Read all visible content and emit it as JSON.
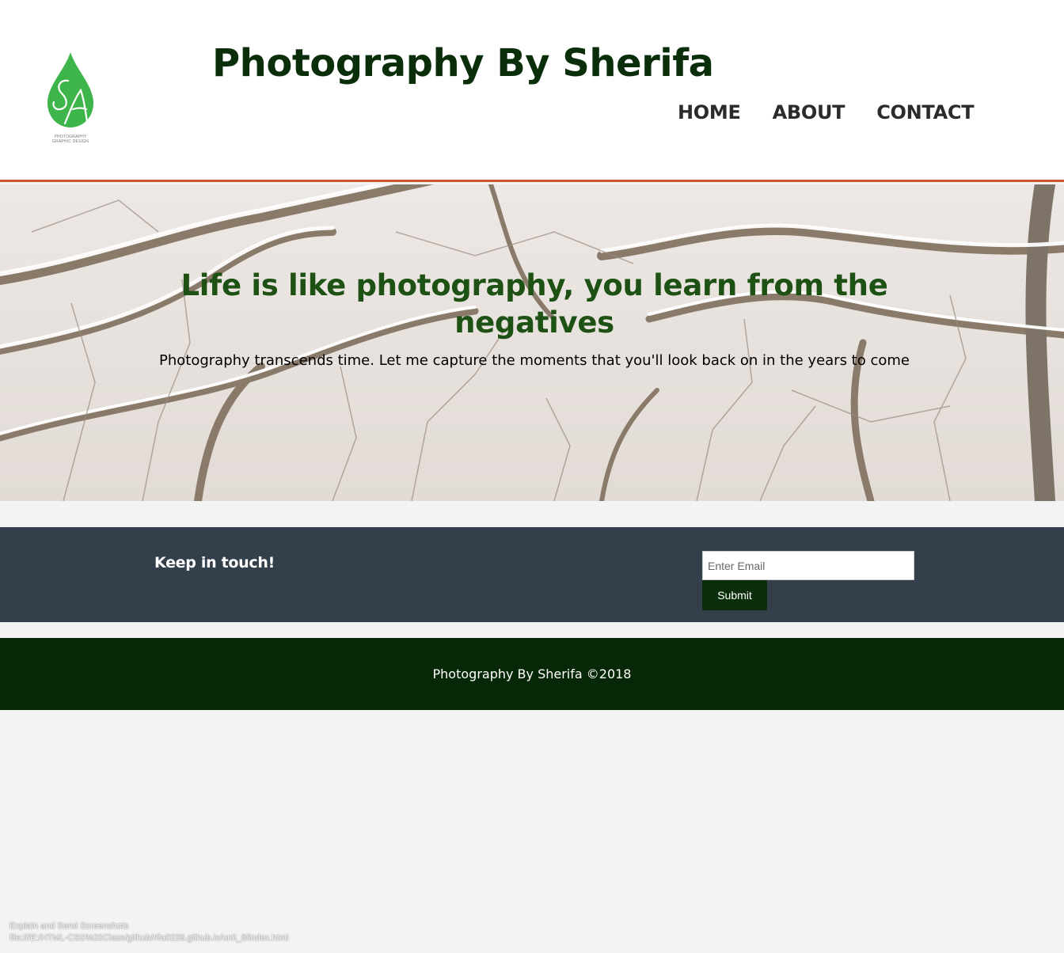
{
  "header": {
    "title": "Photography By Sherifa",
    "logo": {
      "monogram": "SA",
      "caption_lines": [
        "PHOTOGRAPHY",
        "GRAPHIC DESIGN"
      ],
      "color": "#3db54a"
    },
    "nav": [
      {
        "label": "HOME"
      },
      {
        "label": "ABOUT"
      },
      {
        "label": "CONTACT"
      }
    ],
    "accent_border_color": "#c8552d"
  },
  "hero": {
    "heading": "Life is like photography, you learn from the negatives",
    "subtext": "Photography transcends time. Let me capture the moments that you'll look back on in the years to come"
  },
  "newsletter": {
    "heading": "Keep in touch!",
    "email_placeholder": "Enter Email",
    "email_value": "",
    "submit_label": "Submit",
    "background_color": "#333f4a"
  },
  "footer": {
    "text": "Photography By Sherifa ©2018",
    "background_color": "#072806"
  },
  "status_overlay": {
    "line1": "Explain and Send Screenshots",
    "line2": "file:///E:/HTML-CSS%20Class/github/rifa0228.github.io/unit_8/index.html"
  }
}
